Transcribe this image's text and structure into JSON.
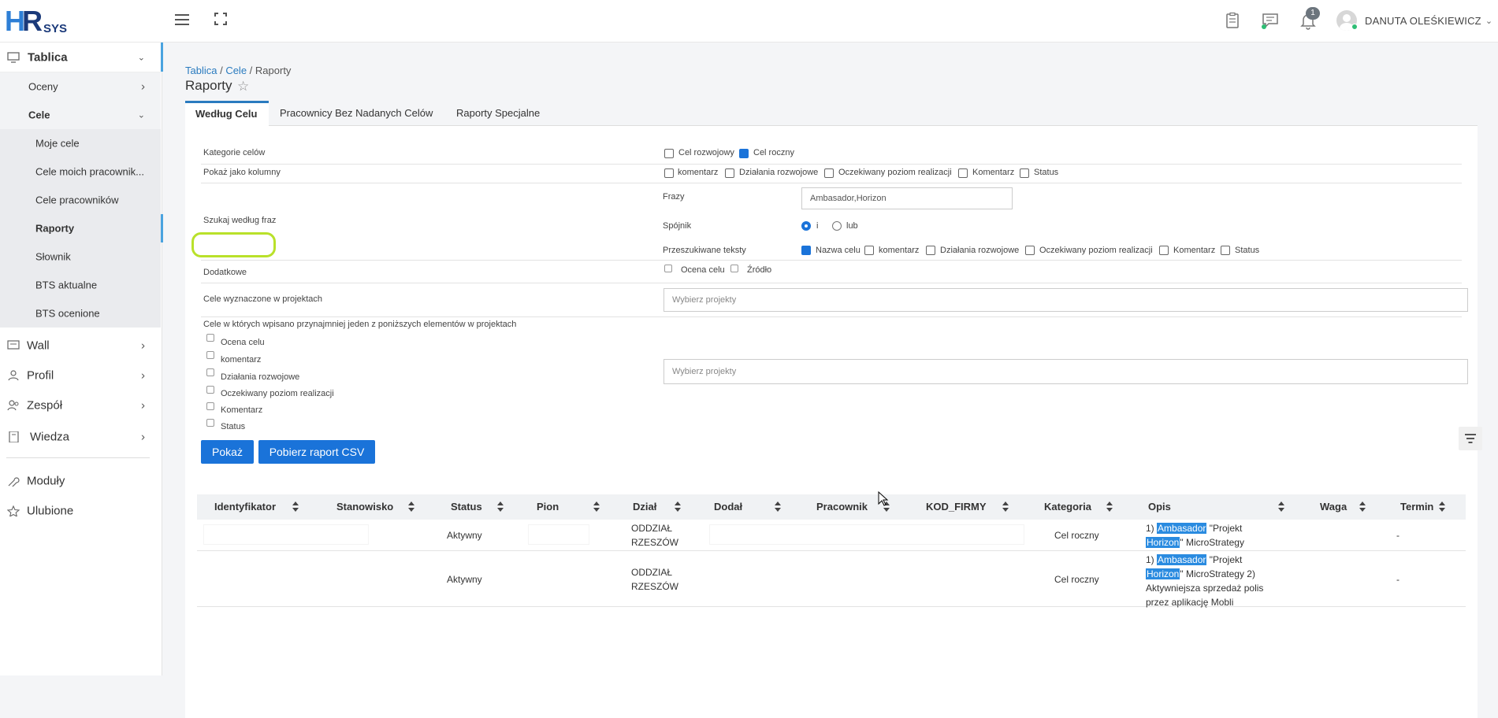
{
  "logo": {
    "hr_h": "H",
    "hr_r": "R",
    "sys": "SYS"
  },
  "header": {
    "user_name": "DANUTA OLEŚKIEWICZ",
    "user_chevron": "⌄",
    "notifications_count": "1"
  },
  "sidebar": {
    "tablica": "Tablica",
    "oceny": "Oceny",
    "cele": "Cele",
    "sub": [
      "Moje cele",
      "Cele moich pracownik...",
      "Cele pracowników",
      "Raporty",
      "Słownik",
      "BTS aktualne",
      "BTS ocenione"
    ],
    "wall": "Wall",
    "profil": "Profil",
    "zespol": "Zespół",
    "wiedza": "Wiedza",
    "moduly": "Moduły",
    "ulubione": "Ulubione",
    "chev_right": "›",
    "chev_down": "⌄"
  },
  "breadcrumb": {
    "b1": "Tablica",
    "sep1": " / ",
    "b2": "Cele",
    "sep2": " / ",
    "b3": "Raporty"
  },
  "page_title": "Raporty",
  "star": "☆",
  "tabs": [
    "Według Celu",
    "Pracownicy Bez Nadanych Celów",
    "Raporty Specjalne"
  ],
  "form": {
    "kategorie_label": "Kategorie celów",
    "kategorie": [
      "Cel rozwojowy",
      "Cel roczny"
    ],
    "pokaz_label": "Pokaż jako kolumny",
    "pokaz": [
      "komentarz",
      "Działania rozwojowe",
      "Oczekiwany poziom realizacji",
      "Komentarz",
      "Status"
    ],
    "szukaj_label": "Szukaj według fraz",
    "frazy_label": "Frazy",
    "frazy_value": "Ambasador,Horizon",
    "spojnik_label": "Spójnik",
    "spojnik": [
      "i",
      "lub"
    ],
    "przeszukiwane_label": "Przeszukiwane teksty",
    "przeszukiwane": [
      "Nazwa celu",
      "komentarz",
      "Działania rozwojowe",
      "Oczekiwany poziom realizacji",
      "Komentarz",
      "Status"
    ],
    "dodatkowe_label": "Dodatkowe",
    "dodatkowe": [
      "Ocena celu",
      "Źródło"
    ],
    "projekty_label": "Cele wyznaczone w projektach",
    "projekty_placeholder": "Wybierz projekty",
    "elementy_label": "Cele w których wpisano przynajmniej jeden z poniższych elementów w projektach",
    "elementy": [
      "Ocena celu",
      "komentarz",
      "Działania rozwojowe",
      "Oczekiwany poziom realizacji",
      "Komentarz",
      "Status"
    ],
    "elementy_placeholder": "Wybierz projekty"
  },
  "buttons": {
    "pokaz": "Pokaż",
    "csv": "Pobierz raport CSV"
  },
  "table": {
    "headers": [
      "Identyfikator",
      "Stanowisko",
      "Status",
      "Pion",
      "Dział",
      "Dodał",
      "Pracownik",
      "KOD_FIRMY",
      "Kategoria",
      "Opis",
      "Waga",
      "Termin"
    ],
    "rows": [
      {
        "status": "Aktywny",
        "dzial_1": "ODDZIAŁ",
        "dzial_2": "RZESZÓW",
        "kategoria": "Cel roczny",
        "opis_a": "1) ",
        "opis_m1": "Ambasador",
        "opis_b": " \"Projekt ",
        "opis_m2": "Horizon",
        "opis_c": "\" MicroStrategy",
        "termin": "-"
      },
      {
        "status": "Aktywny",
        "dzial_1": "ODDZIAŁ",
        "dzial_2": "RZESZÓW",
        "kategoria": "Cel roczny",
        "opis_a": "1) ",
        "opis_m1": "Ambasador",
        "opis_b": " \"Projekt ",
        "opis_m2": "Horizon",
        "opis_c": "\" MicroStrategy 2) Aktywniejsza sprzedaż polis przez aplikację Mobli",
        "termin": "-"
      }
    ]
  }
}
